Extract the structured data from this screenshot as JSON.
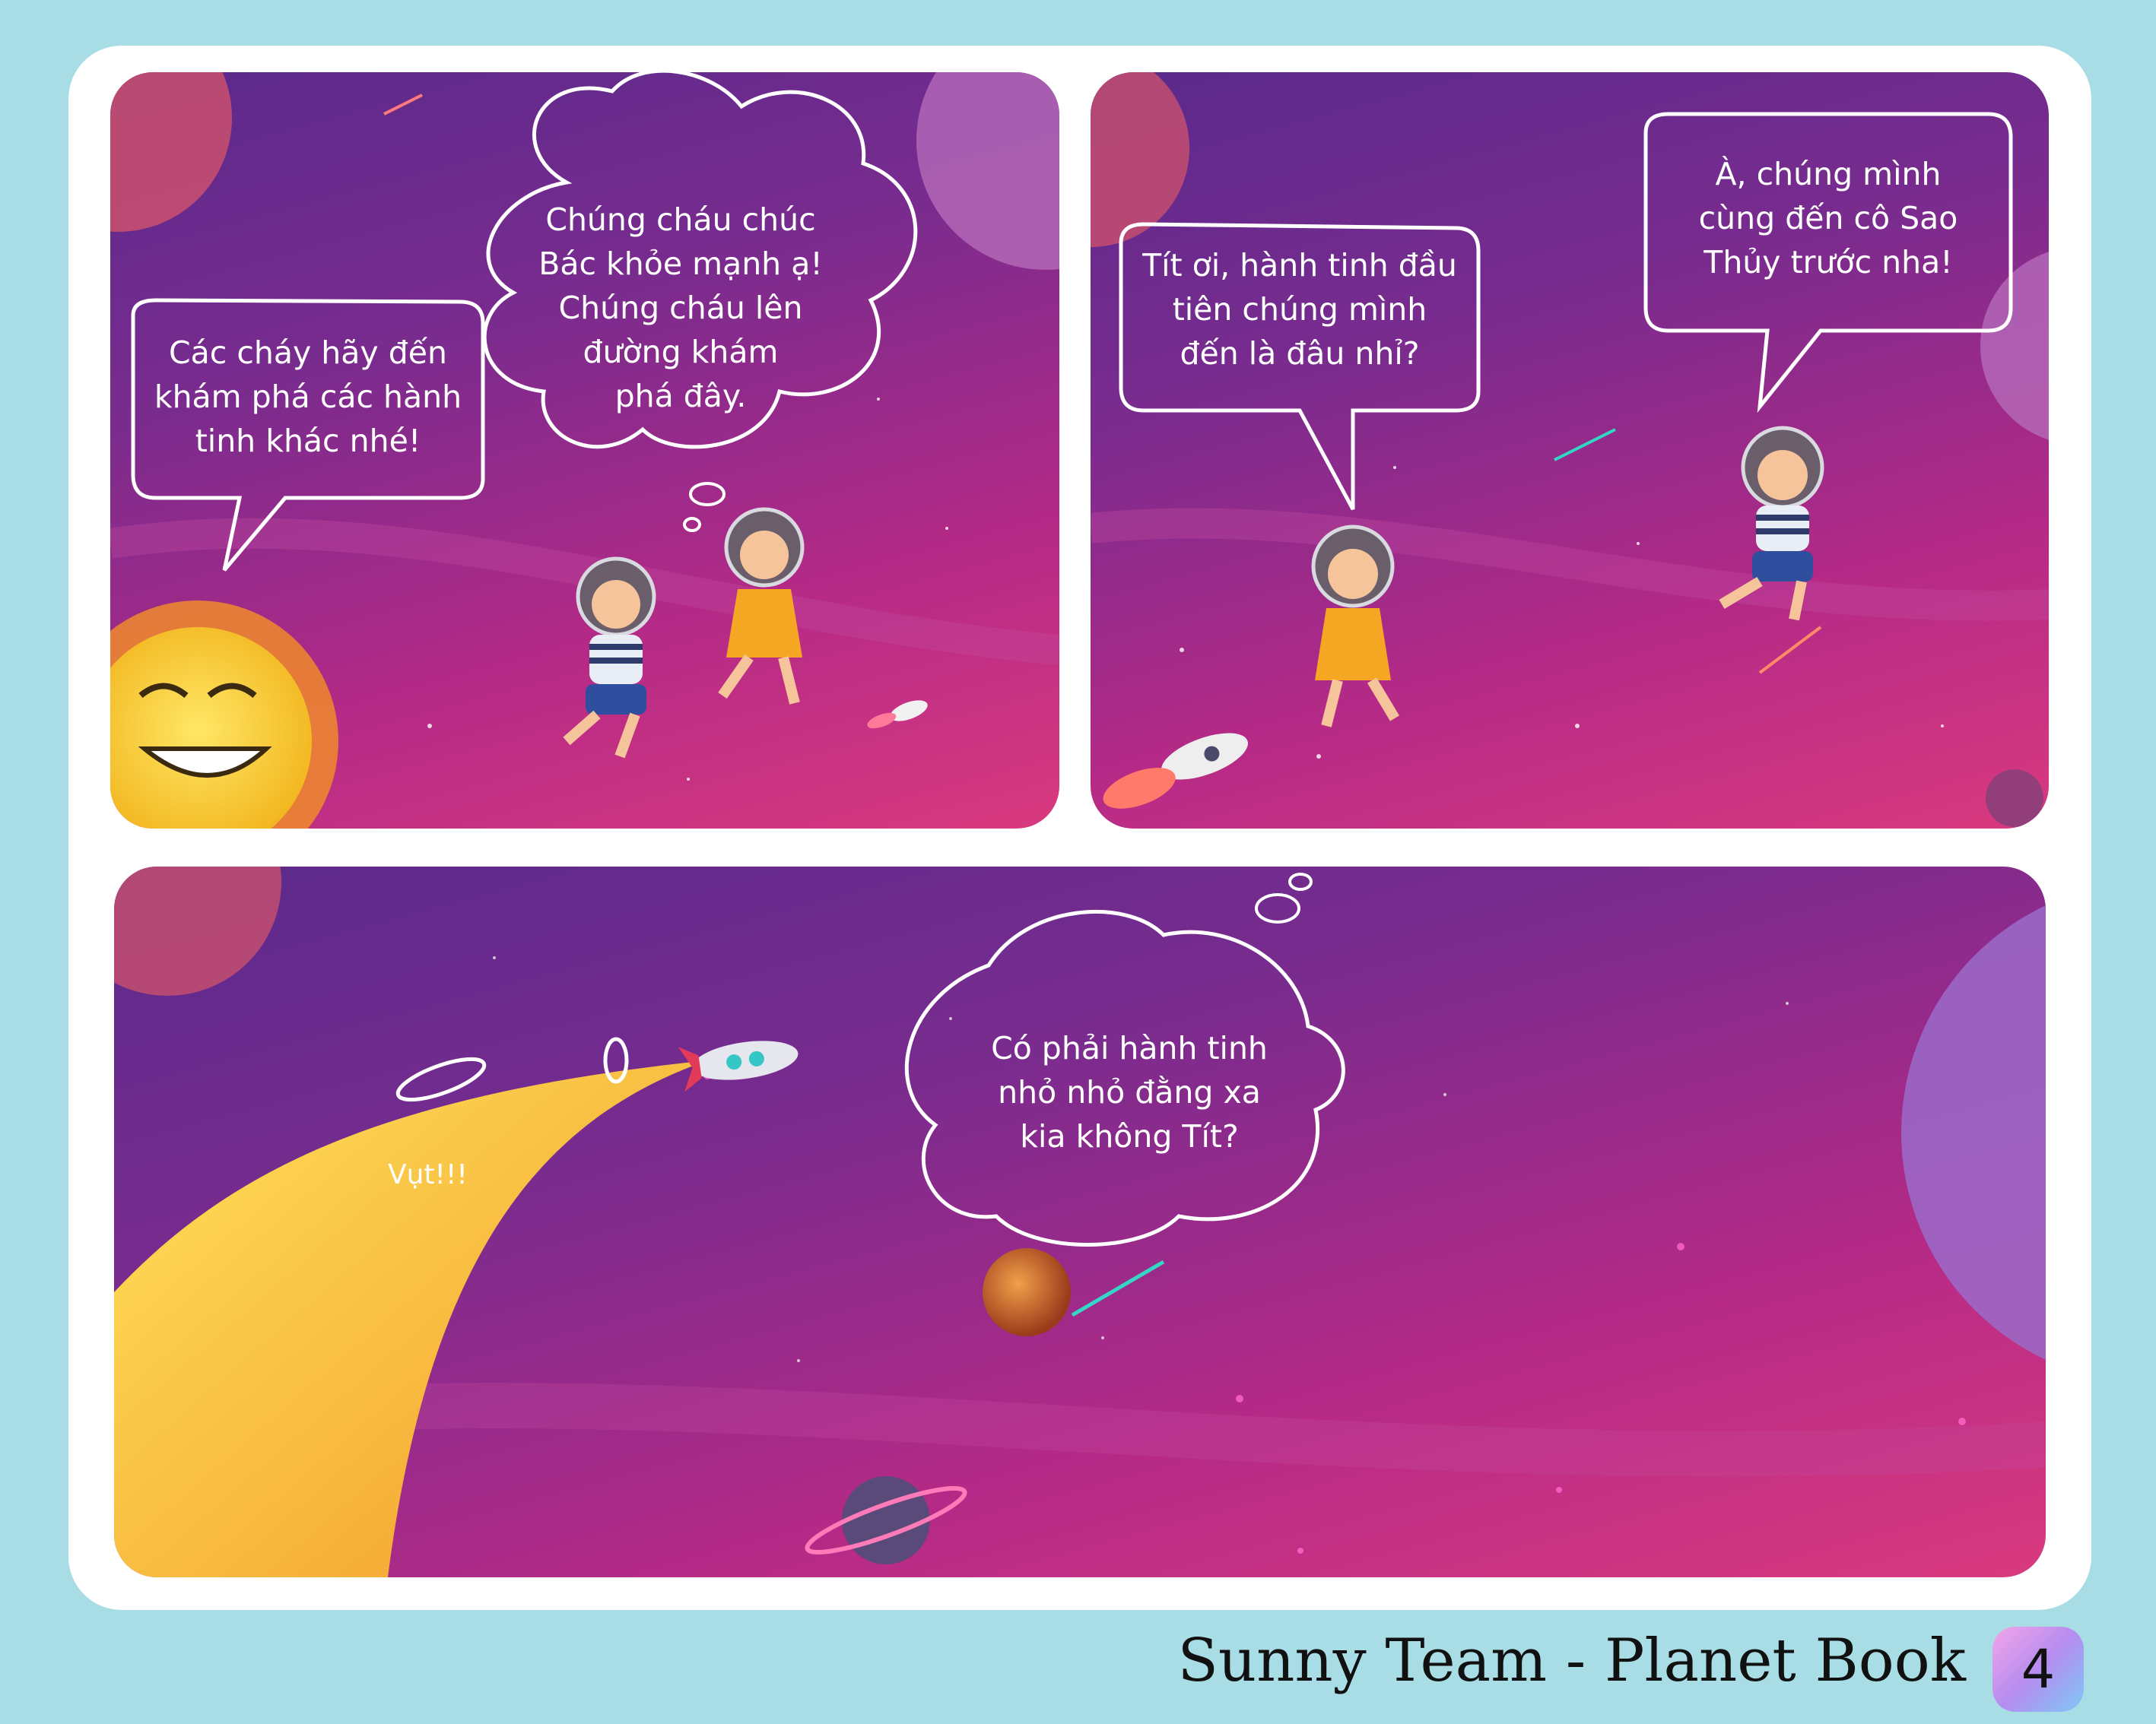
{
  "panels": {
    "p1": {
      "sun_bubble": "Các cháy hãy đến\nkhám phá các hành\ntinh khác nhé!",
      "kids_bubble": "Chúng cháu chúc\nBác khỏe mạnh ạ!\nChúng cháu lên\nđường khám\nphá đây."
    },
    "p2": {
      "girl_bubble": "Tít ơi, hành tinh đầu\ntiên chúng mình\nđến là đâu nhỉ?",
      "boy_bubble": "À, chúng mình\ncùng đến cô Sao\nThủy trước nha!"
    },
    "p3": {
      "thought_bubble": "Có phải hành tinh\nnhỏ nhỏ đằng xa\nkia không Tít?",
      "sound_effect": "Vụt!!!"
    }
  },
  "footer": {
    "title": "Sunny Team - Planet Book",
    "page_number": "4"
  },
  "colors": {
    "page_background": "#a9dde6",
    "panel_purple": "#5a2a8c",
    "panel_magenta": "#d93a7e",
    "sun_yellow": "#f7d23a",
    "sun_rays": "#f08a2c"
  },
  "icons": [
    "sun-icon",
    "planet-icon",
    "rocket-icon",
    "astronaut-boy-icon",
    "astronaut-girl-icon",
    "mercury-planet-icon",
    "comet-icon"
  ]
}
